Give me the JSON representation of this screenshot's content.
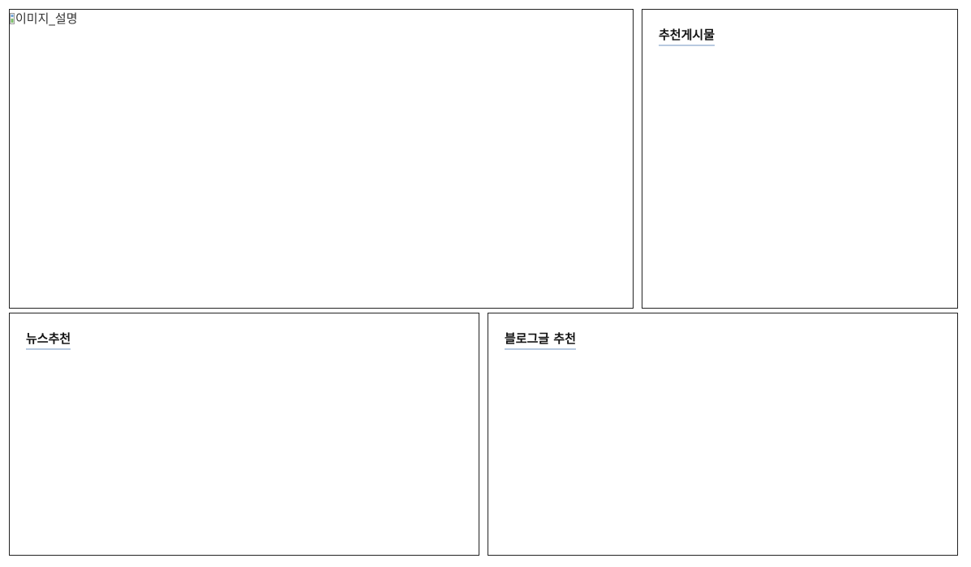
{
  "hero": {
    "image_alt": "이미지_설명",
    "icon": "broken-image-icon"
  },
  "recommended_posts": {
    "title": "추천게시물"
  },
  "news": {
    "title": "뉴스추천"
  },
  "blog": {
    "title": "블로그글 추천"
  },
  "colors": {
    "border": "#222222",
    "title_underline": "#b7c9e0",
    "background": "#ffffff"
  }
}
